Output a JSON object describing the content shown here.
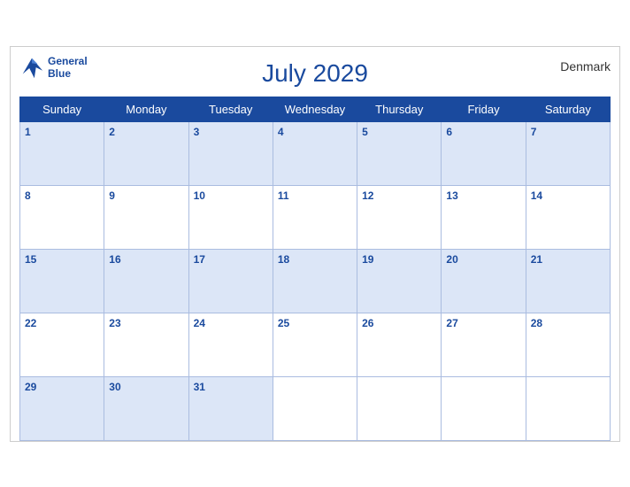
{
  "calendar": {
    "month_title": "July 2029",
    "country": "Denmark",
    "logo": {
      "line1": "General",
      "line2": "Blue"
    },
    "days_of_week": [
      "Sunday",
      "Monday",
      "Tuesday",
      "Wednesday",
      "Thursday",
      "Friday",
      "Saturday"
    ],
    "weeks": [
      [
        1,
        2,
        3,
        4,
        5,
        6,
        7
      ],
      [
        8,
        9,
        10,
        11,
        12,
        13,
        14
      ],
      [
        15,
        16,
        17,
        18,
        19,
        20,
        21
      ],
      [
        22,
        23,
        24,
        25,
        26,
        27,
        28
      ],
      [
        29,
        30,
        31,
        null,
        null,
        null,
        null
      ]
    ]
  }
}
